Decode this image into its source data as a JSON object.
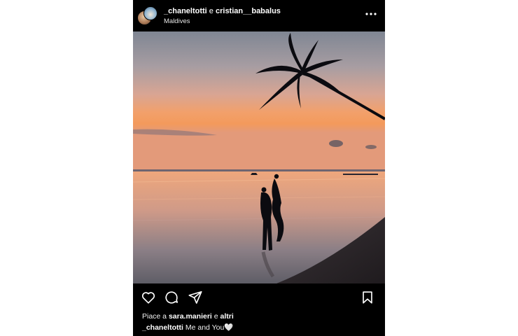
{
  "post": {
    "users": {
      "first": "_chaneltotti",
      "conjunction": "e",
      "second": "cristian__babalus"
    },
    "location": "Maldives",
    "more_icon": "more-horizontal-icon",
    "photo": {
      "description_icon": "sunset-beach-photo",
      "colors": {
        "sky_top": "#8a8f9a",
        "sky_horizon": "#f0935a",
        "sea": "#e9a07c",
        "silhouette": "#0b0b10"
      }
    },
    "actions": {
      "like_icon": "heart-icon",
      "comment_icon": "comment-icon",
      "share_icon": "send-icon",
      "save_icon": "bookmark-icon"
    },
    "likes": {
      "prefix": "Piace a",
      "user": "sara.manieri",
      "conjunction": "e",
      "others": "altri"
    },
    "caption": {
      "user": "_chaneltotti",
      "text": "Me and You🤍"
    }
  }
}
